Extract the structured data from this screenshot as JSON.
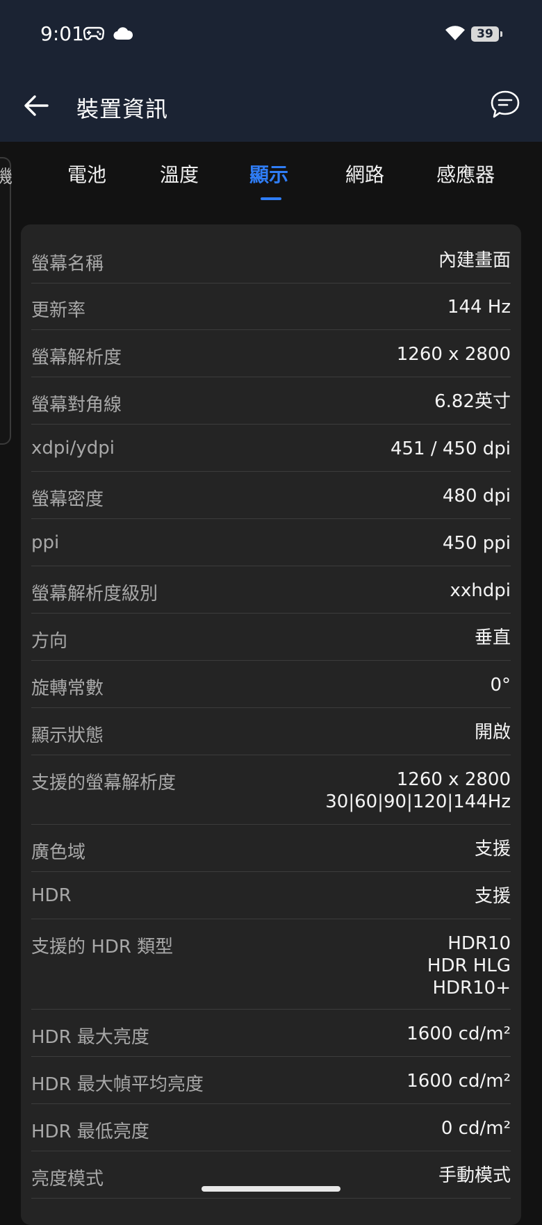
{
  "status_bar": {
    "time": "9:01",
    "battery_level": "39",
    "icons": [
      "gamepad-icon",
      "cloud-icon",
      "wifi-icon",
      "battery-icon"
    ]
  },
  "toolbar": {
    "title": "裝置資訊",
    "back_icon": "arrow-left-icon",
    "feedback_icon": "chat-bubble-icon"
  },
  "tabs": {
    "peek_label": "機",
    "items": [
      {
        "label": "電池"
      },
      {
        "label": "溫度"
      },
      {
        "label": "顯示"
      },
      {
        "label": "網路"
      },
      {
        "label": "感應器"
      }
    ],
    "active_index": 2
  },
  "colors": {
    "accent": "#2f7df6",
    "header_bg": "#1b2333",
    "card_bg": "#242424",
    "page_bg": "#121212"
  },
  "display_info": [
    {
      "label": "螢幕名稱",
      "value": "內建畫面"
    },
    {
      "label": "更新率",
      "value": "144 Hz"
    },
    {
      "label": "螢幕解析度",
      "value": "1260 x 2800"
    },
    {
      "label": "螢幕對角線",
      "value": "6.82英寸"
    },
    {
      "label": "xdpi/ydpi",
      "value": "451 / 450 dpi"
    },
    {
      "label": "螢幕密度",
      "value": "480 dpi"
    },
    {
      "label": "ppi",
      "value": "450 ppi"
    },
    {
      "label": "螢幕解析度級別",
      "value": "xxhdpi"
    },
    {
      "label": "方向",
      "value": "垂直"
    },
    {
      "label": "旋轉常數",
      "value": "0°"
    },
    {
      "label": "顯示狀態",
      "value": "開啟"
    },
    {
      "label": "支援的螢幕解析度",
      "value": "1260 x 2800\n30|60|90|120|144Hz"
    },
    {
      "label": "廣色域",
      "value": "支援"
    },
    {
      "label": "HDR",
      "value": "支援"
    },
    {
      "label": "支援的 HDR 類型",
      "value": "HDR10\nHDR HLG\nHDR10+"
    },
    {
      "label": "HDR 最大亮度",
      "value": "1600 cd/m²"
    },
    {
      "label": "HDR 最大幀平均亮度",
      "value": "1600 cd/m²"
    },
    {
      "label": "HDR 最低亮度",
      "value": "0 cd/m²"
    },
    {
      "label": "亮度模式",
      "value": "手動模式"
    }
  ]
}
